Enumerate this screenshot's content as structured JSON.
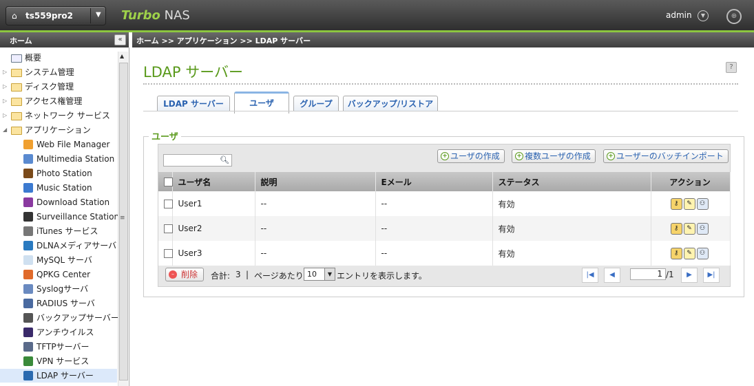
{
  "header": {
    "host_icon": "home-icon",
    "host_name": "ts559pro2",
    "brand_bold": "Turbo",
    "brand_rest": "NAS",
    "username": "admin",
    "globe_icon": "globe-icon"
  },
  "sidebar": {
    "title": "ホーム",
    "collapse_glyph": "«",
    "folders": [
      {
        "label": "概要"
      },
      {
        "label": "システム管理"
      },
      {
        "label": "ディスク管理"
      },
      {
        "label": "アクセス権管理"
      },
      {
        "label": "ネットワーク サービス"
      },
      {
        "label": "アプリケーション"
      }
    ],
    "apps": [
      {
        "label": "Web File Manager",
        "color": "#f0a030"
      },
      {
        "label": "Multimedia Station",
        "color": "#5a8ad0"
      },
      {
        "label": "Photo Station",
        "color": "#7a4a1a"
      },
      {
        "label": "Music Station",
        "color": "#3c7ad0"
      },
      {
        "label": "Download Station",
        "color": "#8a3aa0"
      },
      {
        "label": "Surveillance Station",
        "color": "#333333"
      },
      {
        "label": "iTunes サービス",
        "color": "#777777"
      },
      {
        "label": "DLNAメディアサーバ",
        "color": "#2a7ac0"
      },
      {
        "label": "MySQL サーバ",
        "color": "#cfe0f0"
      },
      {
        "label": "QPKG Center",
        "color": "#e06a2a"
      },
      {
        "label": "Syslogサーバ",
        "color": "#6a8ac0"
      },
      {
        "label": "RADIUS サーバ",
        "color": "#4a6aa0"
      },
      {
        "label": "バックアップサーバー",
        "color": "#555555"
      },
      {
        "label": "アンチウイルス",
        "color": "#3a2a6a"
      },
      {
        "label": "TFTPサーバー",
        "color": "#5a6a8a"
      },
      {
        "label": "VPN サービス",
        "color": "#3a8a3a"
      },
      {
        "label": "LDAP サーバー",
        "color": "#2a6ab0"
      }
    ]
  },
  "breadcrumb": "ホーム >> アプリケーション >> LDAP サーバー",
  "page": {
    "title": "LDAP サーバー",
    "help_glyph": "?",
    "tabs": [
      {
        "label": "LDAP サーバー"
      },
      {
        "label": "ユーザ"
      },
      {
        "label": "グループ"
      },
      {
        "label": "バックアップ/リストア"
      }
    ],
    "section_legend": "ユーザ"
  },
  "toolbar": {
    "search_placeholder": "",
    "create_user": "ユーザの作成",
    "create_multi": "複数ユーザの作成",
    "batch_import": "ユーザーのバッチインポート"
  },
  "table": {
    "columns": [
      "ユーザ名",
      "説明",
      "Eメール",
      "ステータス",
      "アクション"
    ],
    "rows": [
      {
        "name": "User1",
        "desc": "--",
        "email": "--",
        "status": "有効"
      },
      {
        "name": "User2",
        "desc": "--",
        "email": "--",
        "status": "有効"
      },
      {
        "name": "User3",
        "desc": "--",
        "email": "--",
        "status": "有効"
      }
    ]
  },
  "footer": {
    "delete_label": "削除",
    "total_label": "合計:",
    "total_value": "3",
    "sep": "|",
    "per_page_label": "ページあたり",
    "per_page_value": "10",
    "show_entries": "エントリを表示します。",
    "page_current": "1",
    "page_total": "/1"
  }
}
